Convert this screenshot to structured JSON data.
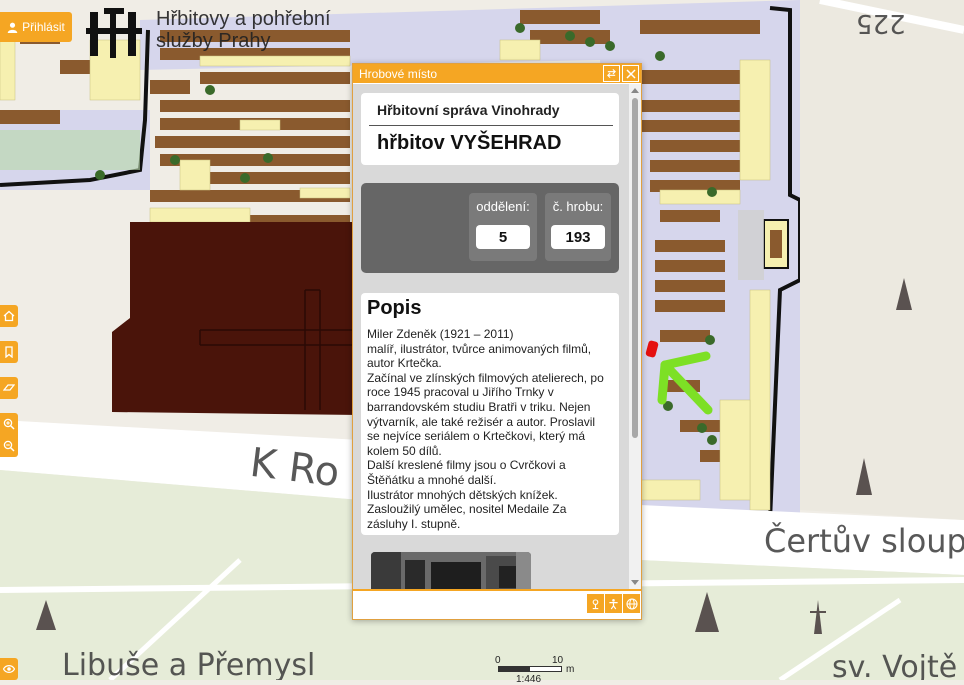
{
  "header": {
    "login_label": "Přihlásit",
    "logo_line1": "Hřbitovy a pohřební",
    "logo_line2": "služby Prahy"
  },
  "map": {
    "labels": {
      "street_k_rotunde": "K Ro",
      "certuv_sloup": "Čertův sloup",
      "libuse": "Libuše a Přemysl",
      "sv_vojtech": "sv. Vojtě",
      "number_225": "225"
    },
    "scale": {
      "zero": "0",
      "ten": "10",
      "unit": "m",
      "ratio": "1:446"
    },
    "colors": {
      "block": "#8a5a2e",
      "light": "#f6f0b0",
      "path": "#d6d6ec",
      "dark": "#4a140a"
    }
  },
  "popup": {
    "title": "Hrobové místo",
    "admin": "Hřbitovní správa Vinohrady",
    "cemetery": "hřbitov VYŠEHRAD",
    "section_label": "oddělení:",
    "section_value": "5",
    "grave_label": "č. hrobu:",
    "grave_value": "193",
    "desc_heading": "Popis",
    "desc_lines": [
      "Miler Zdeněk (1921 – 2011)",
      "malíř, ilustrátor, tvůrce animovaných filmů,",
      "autor Krtečka.",
      "Začínal ve zlínských filmových atelierech, po",
      "roce 1945 pracoval u Jiřího Trnky v",
      "barrandovském studiu Bratři v triku. Nejen",
      "výtvarník, ale také režisér a autor. Proslavil",
      "se nejvíce seriálem o Krtečkovi, který má",
      "kolem 50 dílů.",
      "Další kreslené filmy jsou o Cvrčkovi a",
      "Štěňátku a mnohé další.",
      "Ilustrátor mnohých dětských knížek.",
      "Zasloužilý umělec, nositel Medaile Za",
      "zásluhy I. stupně."
    ]
  }
}
